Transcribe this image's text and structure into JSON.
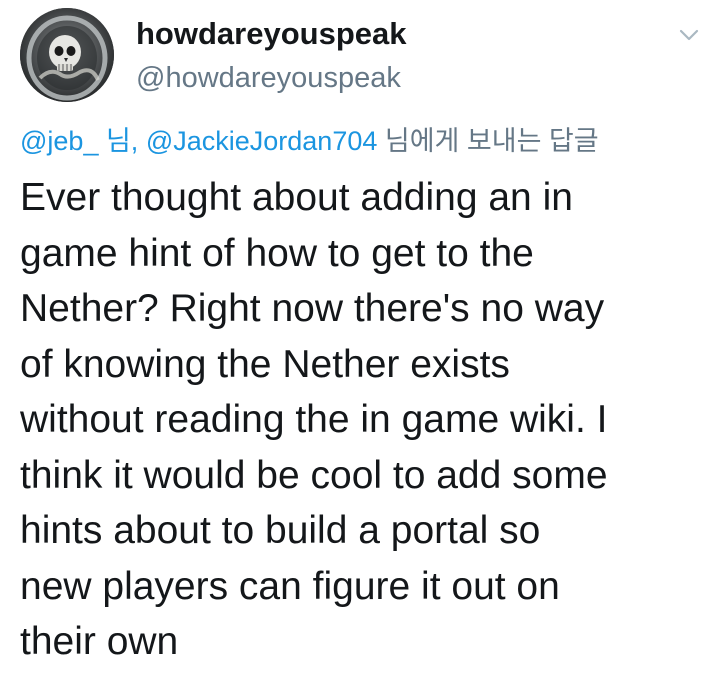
{
  "user": {
    "display_name": "howdareyouspeak",
    "handle": "@howdareyouspeak",
    "avatar_icon": "skull-avatar-icon"
  },
  "menu": {
    "icon": "chevron-down-icon"
  },
  "reply_to": {
    "mention_1": "@jeb_",
    "suffix_1": " 님, ",
    "mention_2": "@JackieJordan704",
    "suffix_2": " 님에게 보내는 답글"
  },
  "tweet": {
    "lines": [
      "Ever thought about adding an in",
      "game hint of how to get to the",
      "Nether? Right now there's no way",
      "of knowing the Nether exists",
      "without reading the in game wiki. I",
      "think it would be cool to add some",
      "hints about to build a portal so",
      "new players can figure it out on",
      "their own"
    ]
  },
  "colors": {
    "text": "#14171a",
    "secondary": "#657786",
    "link": "#1b95e0",
    "background": "#ffffff"
  }
}
